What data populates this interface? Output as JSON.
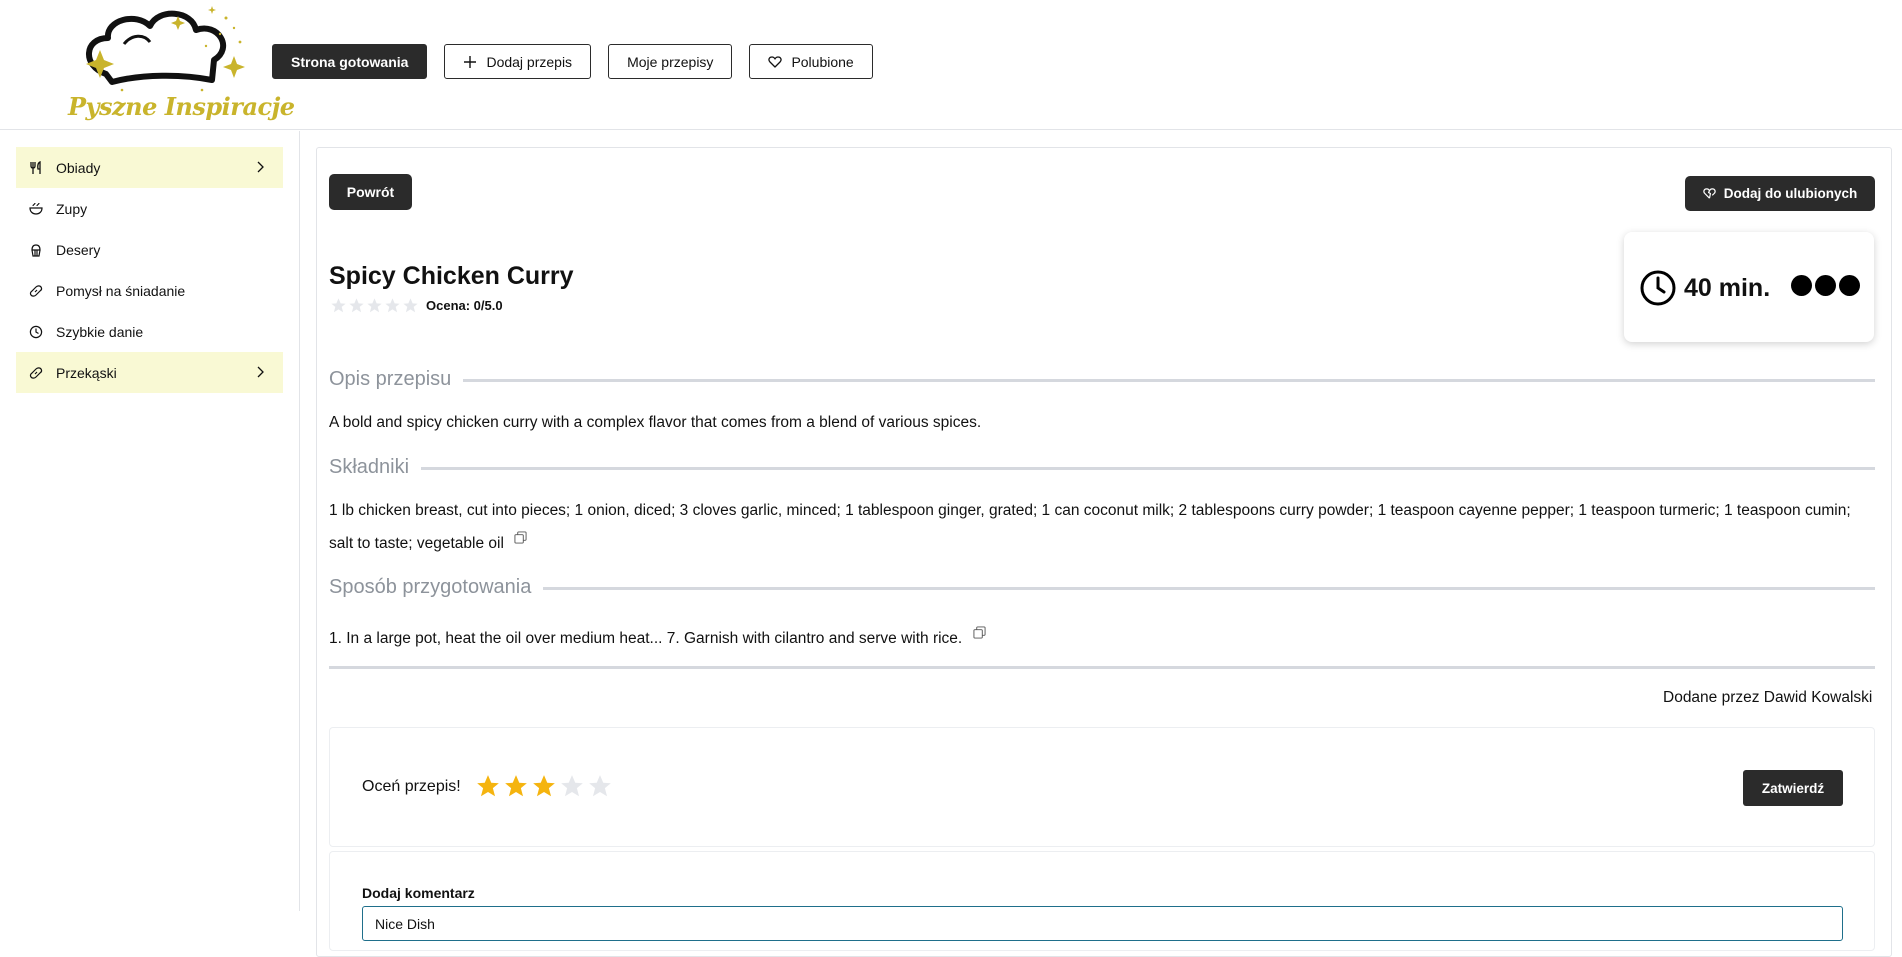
{
  "brand": {
    "name": "Pyszne Inspiracje"
  },
  "nav": {
    "home": "Strona gotowania",
    "add_recipe": "Dodaj przepis",
    "my_recipes": "Moje przepisy",
    "liked": "Polubione"
  },
  "sidebar": {
    "items": [
      {
        "label": "Obiady",
        "icon": "utensils-icon",
        "has_submenu": true
      },
      {
        "label": "Zupy",
        "icon": "bowl-icon",
        "has_submenu": false
      },
      {
        "label": "Desery",
        "icon": "cupcake-icon",
        "has_submenu": false
      },
      {
        "label": "Pomysł na śniadanie",
        "icon": "link-icon",
        "has_submenu": false
      },
      {
        "label": "Szybkie danie",
        "icon": "clock-icon",
        "has_submenu": false
      },
      {
        "label": "Przekąski",
        "icon": "link-icon",
        "has_submenu": true
      }
    ]
  },
  "recipe": {
    "back_label": "Powrót",
    "favorite_label": "Dodaj do ulubionych",
    "title": "Spicy Chicken Curry",
    "rating": {
      "value": 0,
      "max": 5,
      "label": "Ocena: 0/5.0"
    },
    "time": "40 min.",
    "difficulty_level": 3,
    "sections": {
      "description_title": "Opis przepisu",
      "description": "A bold and spicy chicken curry with a complex flavor that comes from a blend of various spices.",
      "ingredients_title": "Składniki",
      "ingredients": "1 lb chicken breast, cut into pieces; 1 onion, diced; 3 cloves garlic, minced; 1 tablespoon ginger, grated; 1 can coconut milk; 2 tablespoons curry powder; 1 teaspoon cayenne pepper; 1 teaspoon turmeric; 1 teaspoon cumin; salt to taste; vegetable oil",
      "method_title": "Sposób przygotowania",
      "method": "1. In a large pot, heat the oil over medium heat... 7. Garnish with cilantro and serve with rice."
    },
    "added_by": "Dodane przez Dawid Kowalski"
  },
  "rate": {
    "label": "Oceń przepis!",
    "selected": 3,
    "max": 5,
    "submit_label": "Zatwierdź"
  },
  "comment": {
    "label": "Dodaj komentarz",
    "value": "Nice Dish"
  },
  "colors": {
    "brand_gold": "#c9b42c",
    "dark": "#2b2b2b",
    "highlight": "#f9f9d4",
    "star_active": "#f5b40f",
    "star_inactive": "#e5e7eb"
  }
}
